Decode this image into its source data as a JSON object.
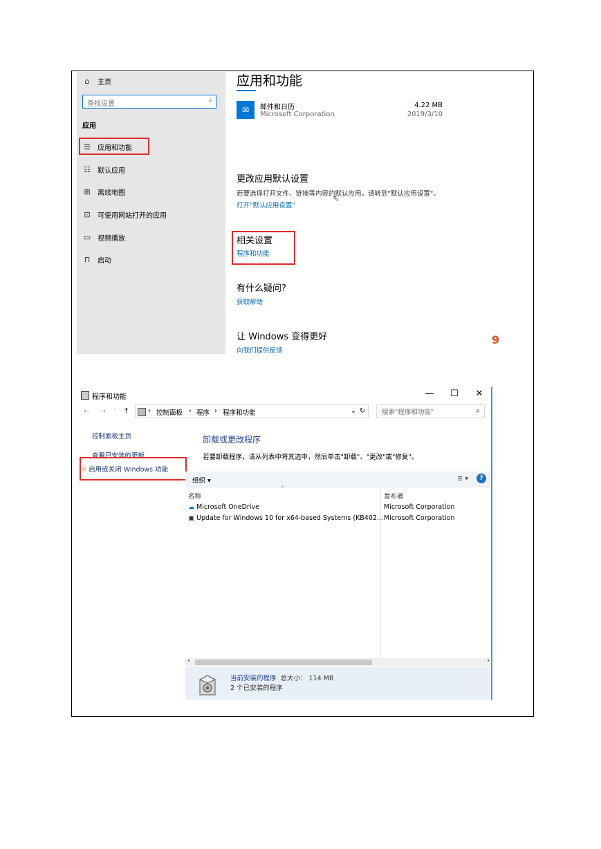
{
  "settings": {
    "sidebar": {
      "home": "主页",
      "search_placeholder": "查找设置",
      "section": "应用",
      "items": [
        {
          "label": "应用和功能",
          "icon": "apps-features-icon"
        },
        {
          "label": "默认应用",
          "icon": "default-apps-icon"
        },
        {
          "label": "离线地图",
          "icon": "offline-maps-icon"
        },
        {
          "label": "可使用网站打开的应用",
          "icon": "apps-for-websites-icon"
        },
        {
          "label": "视频播放",
          "icon": "video-playback-icon"
        },
        {
          "label": "启动",
          "icon": "startup-icon"
        }
      ]
    },
    "main": {
      "title": "应用和功能",
      "app": {
        "name": "邮件和日历",
        "publisher": "Microsoft Corporation",
        "size": "4.22 MB",
        "date": "2019/3/10"
      },
      "default_section": {
        "heading": "更改应用默认设置",
        "description": "若要选择打开文件、链接等内容的默认应用，请转到\"默认应用设置\"。",
        "link": "打开\"默认应用设置\""
      },
      "related": {
        "heading": "相关设置",
        "link": "程序和功能"
      },
      "question": {
        "heading": "有什么疑问?",
        "link": "获取帮助"
      },
      "improve": {
        "heading": "让 Windows 变得更好",
        "link": "向我们提供反馈"
      },
      "edge_glyph": "9"
    }
  },
  "programs": {
    "title": "程序和功能",
    "window_buttons": {
      "minimize": "—",
      "maximize": "☐",
      "close": "✕"
    },
    "breadcrumbs": [
      "控制面板",
      "程序",
      "程序和功能"
    ],
    "search_placeholder": "搜索\"程序和功能\"",
    "left_links": [
      "控制面板主页",
      "查看已安装的更新",
      "启用或关闭 Windows 功能"
    ],
    "heading": "卸载或更改程序",
    "description": "若要卸载程序，请从列表中将其选中，然后单击\"卸载\"、\"更改\"或\"修复\"。",
    "toolbar": {
      "organize": "组织 ▾",
      "view": "≣ ▾",
      "help": "?"
    },
    "columns": {
      "name": "名称",
      "publisher": "发布者"
    },
    "rows": [
      {
        "name": "Microsoft OneDrive",
        "publisher": "Microsoft Corporation",
        "icon": "onedrive-icon"
      },
      {
        "name": "Update for Windows 10 for x64-based Systems (KB402...",
        "publisher": "Microsoft Corporation",
        "icon": "update-icon"
      }
    ],
    "status": {
      "label": "当前安装的程序",
      "total": "总大小：  114 MB",
      "count": "2 个已安装的程序"
    }
  }
}
